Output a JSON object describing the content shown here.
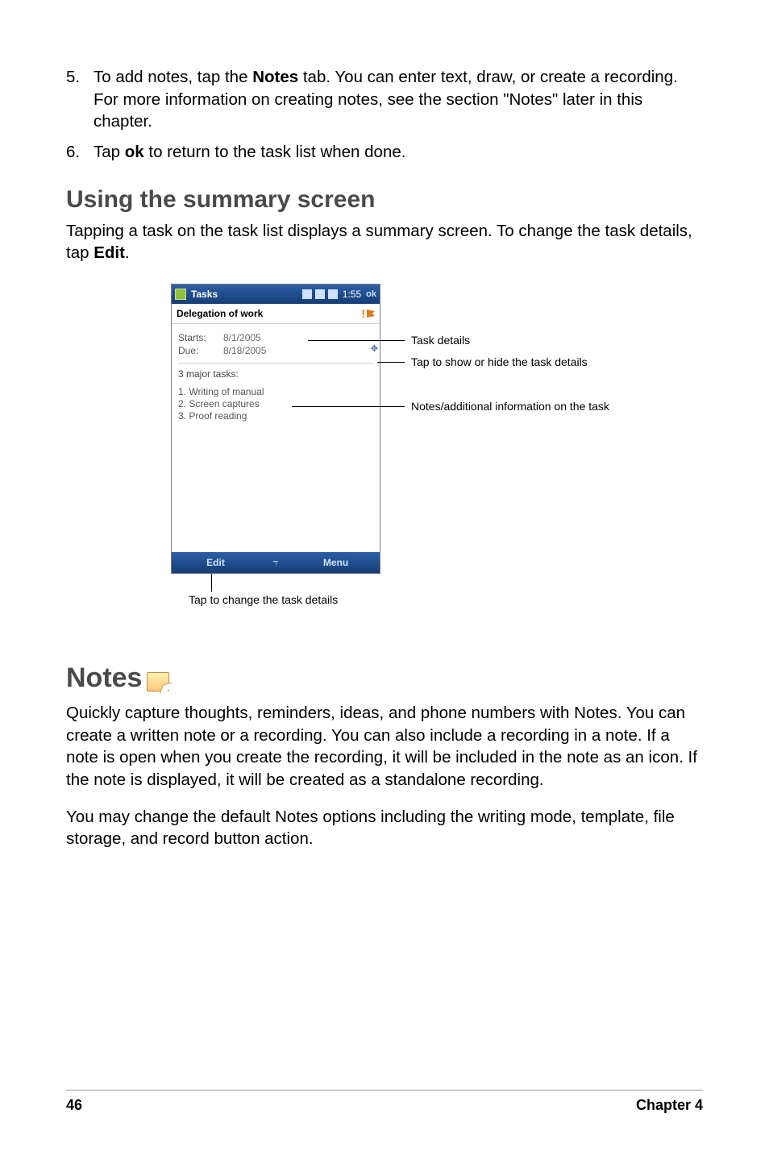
{
  "list": {
    "item5_num": "5.",
    "item5_text_a": "To add notes, tap the ",
    "item5_bold": "Notes",
    "item5_text_b": " tab. You can enter text, draw, or create a recording. For more information on creating notes, see the section \"Notes\" later in this chapter.",
    "item6_num": "6.",
    "item6_text_a": "Tap ",
    "item6_bold": "ok",
    "item6_text_b": " to return to the task list when done."
  },
  "section_heading": "Using the summary screen",
  "section_lead_a": "Tapping a task on the task list displays a summary screen. To change the task details, tap ",
  "section_lead_bold": "Edit",
  "section_lead_b": ".",
  "phone": {
    "app_title": "Tasks",
    "time": "1:55",
    "ok": "ok",
    "subject": "Delegation of work",
    "flag_mark": "!",
    "starts_label": "Starts:",
    "starts_value": "8/1/2005",
    "due_label": "Due:",
    "due_value": "8/18/2005",
    "major": "3 major tasks:",
    "n1": "1. Writing of manual",
    "n2": "2. Screen captures",
    "n3": "3. Proof reading",
    "menu_edit": "Edit",
    "menu_mid": "⥾",
    "menu_menu": "Menu"
  },
  "callouts": {
    "task_details": "Task details",
    "show_hide": "Tap to show or hide the task details",
    "notes_info": "Notes/additional information on the task",
    "edit_caption": "Tap to change the task details"
  },
  "notes_heading": "Notes",
  "notes_p1": "Quickly capture thoughts, reminders, ideas, and phone numbers with Notes. You can create a written note or a recording. You can also include a recording in a note. If a note is open when you create the recording, it will be included in the note as an icon. If the note is displayed, it will be created as a standalone recording.",
  "notes_p2": "You may change the default Notes options including the writing mode, template, file storage, and record button action.",
  "footer": {
    "page": "46",
    "chapter": "Chapter 4"
  }
}
